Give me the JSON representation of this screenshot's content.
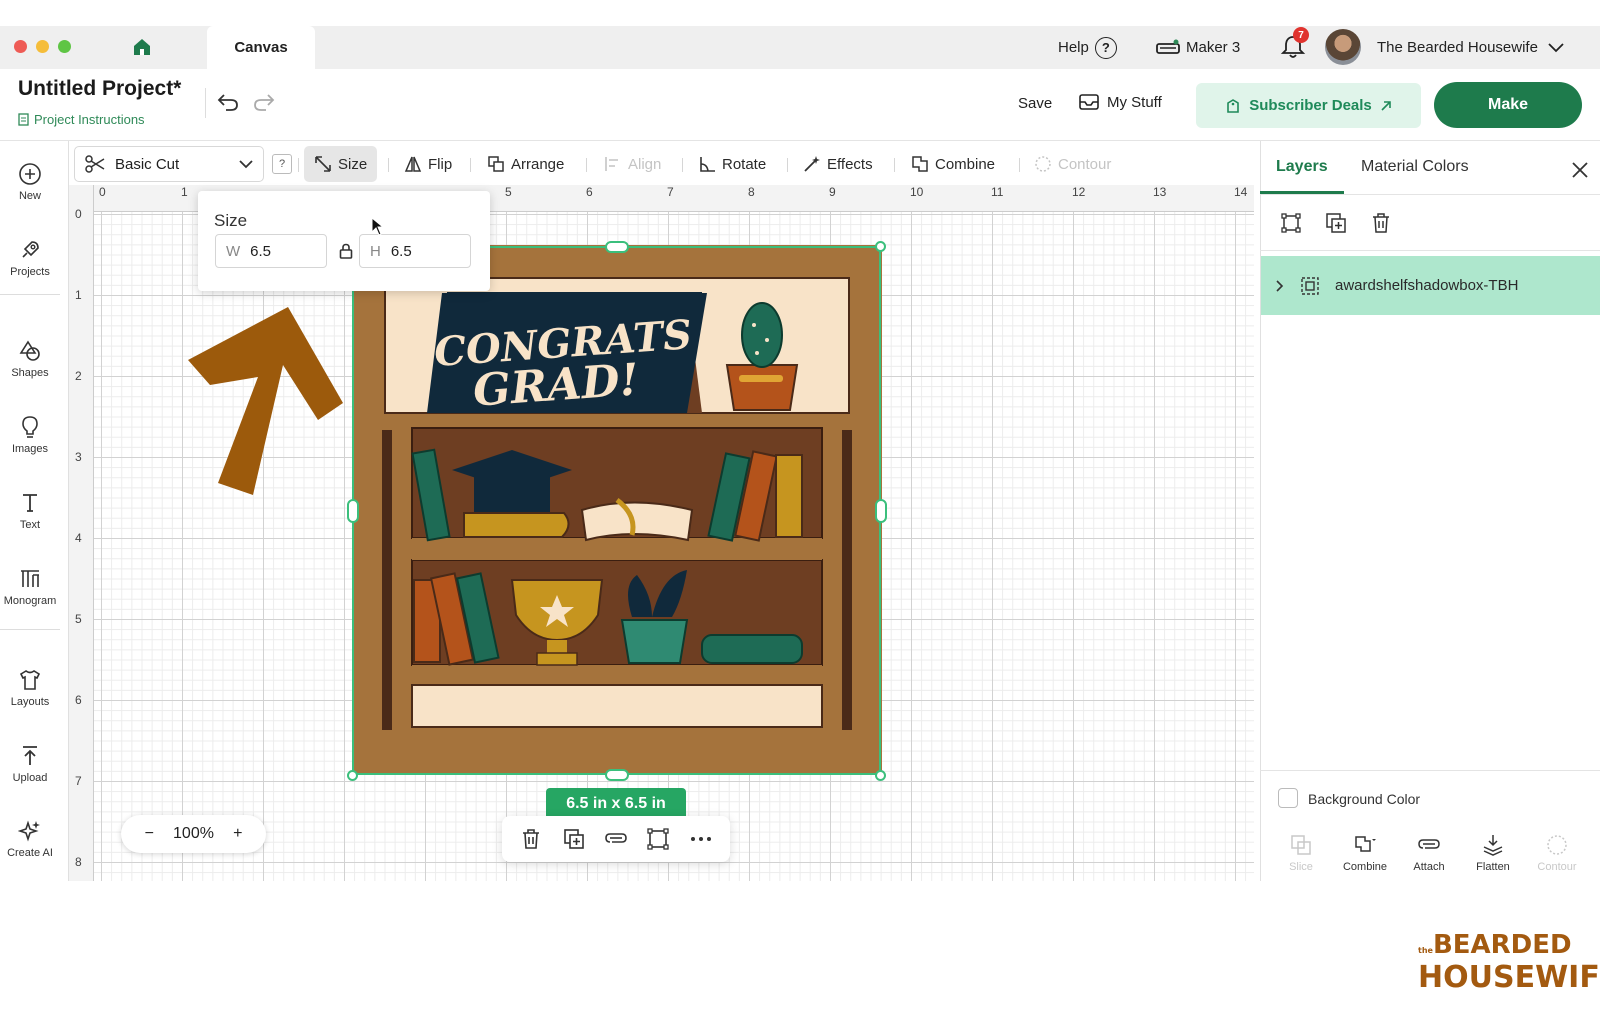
{
  "titlebar": {
    "tab_label": "Canvas",
    "help_label": "Help",
    "machine_label": "Maker 3",
    "notification_count": "7",
    "account_name": "The Bearded Housewife"
  },
  "header": {
    "project_title": "Untitled Project*",
    "project_instructions": "Project Instructions",
    "save_label": "Save",
    "my_stuff_label": "My Stuff",
    "subscriber_deals_label": "Subscriber Deals",
    "make_label": "Make"
  },
  "sidebar": {
    "items": [
      {
        "label": "New",
        "icon": "plus-circle-icon"
      },
      {
        "label": "Projects",
        "icon": "rocket-icon"
      },
      {
        "label": "Shapes",
        "icon": "shapes-icon"
      },
      {
        "label": "Images",
        "icon": "lightbulb-icon"
      },
      {
        "label": "Text",
        "icon": "text-icon"
      },
      {
        "label": "Monogram",
        "icon": "monogram-icon"
      },
      {
        "label": "Layouts",
        "icon": "tshirt-icon"
      },
      {
        "label": "Upload",
        "icon": "upload-icon"
      },
      {
        "label": "Create AI",
        "icon": "sparkle-icon"
      }
    ]
  },
  "toolbar": {
    "operation": "Basic Cut",
    "help_label": "?",
    "size_label": "Size",
    "flip_label": "Flip",
    "arrange_label": "Arrange",
    "align_label": "Align",
    "rotate_label": "Rotate",
    "effects_label": "Effects",
    "combine_label": "Combine",
    "contour_label": "Contour"
  },
  "ruler": {
    "top": [
      "0",
      "1",
      "5",
      "6",
      "7",
      "8",
      "9",
      "10",
      "11",
      "12",
      "13",
      "14"
    ],
    "left": [
      "0",
      "1",
      "2",
      "3",
      "4",
      "5",
      "6",
      "7",
      "8"
    ]
  },
  "size_popover": {
    "title": "Size",
    "w_prefix": "W",
    "w_value": "6.5",
    "h_prefix": "H",
    "h_value": "6.5"
  },
  "canvas": {
    "design_text_line1": "CONGRATS",
    "design_text_line2": "GRAD!",
    "dimensions_label": "6.5 in x 6.5 in",
    "zoom_minus": "−",
    "zoom_level": "100%",
    "zoom_plus": "+"
  },
  "right_panel": {
    "tab_layers": "Layers",
    "tab_material_colors": "Material Colors",
    "layer_name": "awardshelfshadowbox-TBH",
    "background_color_label": "Background Color",
    "bottom_tools": [
      {
        "label": "Slice",
        "enabled": false
      },
      {
        "label": "Combine",
        "enabled": true
      },
      {
        "label": "Attach",
        "enabled": true
      },
      {
        "label": "Flatten",
        "enabled": true
      },
      {
        "label": "Contour",
        "enabled": false
      }
    ]
  },
  "watermark": {
    "line_small": "the",
    "line1": "BEARDED",
    "line2": "HOUSEWIFE"
  },
  "colors": {
    "accent_green": "#1e7b4c",
    "selection_green": "#3bbf7c",
    "arrow_brown": "#9c5a0c"
  }
}
